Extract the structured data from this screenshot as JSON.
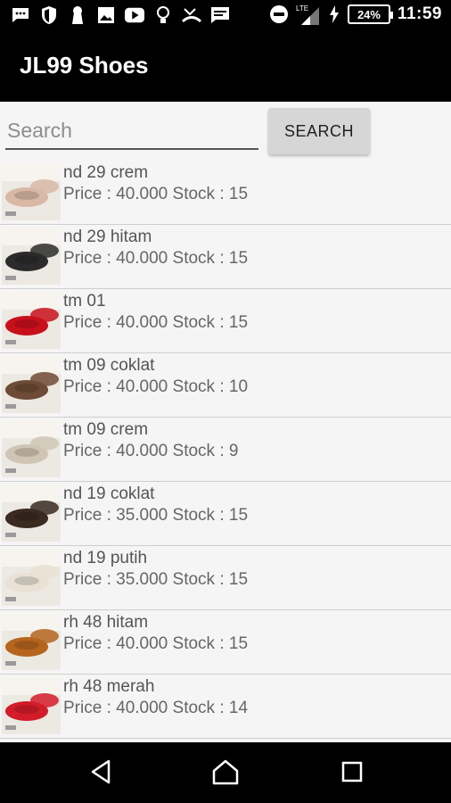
{
  "status_bar": {
    "time": "11:59",
    "battery": "24%",
    "network": "LTE",
    "icons": [
      "messages-icon",
      "shield-icon",
      "keyhole-icon",
      "image-icon",
      "youtube-icon",
      "lightbulb-icon",
      "missed-call-icon",
      "sms-icon",
      "do-not-disturb-icon",
      "signal-icon",
      "charging-icon"
    ]
  },
  "app": {
    "title": "JL99 Shoes"
  },
  "search": {
    "placeholder": "Search",
    "value": "",
    "button_label": "SEARCH"
  },
  "products": [
    {
      "name": "nd 29 crem",
      "details": "Price : 40.000 Stock : 15",
      "thumb_color": "#d9b8a6"
    },
    {
      "name": "nd 29 hitam",
      "details": "Price : 40.000 Stock : 15",
      "thumb_color": "#2b2b2b"
    },
    {
      "name": "tm 01",
      "details": "Price : 40.000 Stock : 15",
      "thumb_color": "#c8101c"
    },
    {
      "name": "tm 09 coklat",
      "details": "Price : 40.000 Stock : 10",
      "thumb_color": "#6e4b36"
    },
    {
      "name": "tm 09 crem",
      "details": "Price : 40.000 Stock : 9",
      "thumb_color": "#cfc5b4"
    },
    {
      "name": "nd 19 coklat",
      "details": "Price : 35.000 Stock : 15",
      "thumb_color": "#3a2a20"
    },
    {
      "name": "nd 19 putih",
      "details": "Price : 35.000 Stock : 15",
      "thumb_color": "#e9e2d4"
    },
    {
      "name": "rh 48 hitam",
      "details": "Price : 40.000 Stock : 15",
      "thumb_color": "#b5651d"
    },
    {
      "name": "rh 48 merah",
      "details": "Price : 40.000 Stock : 14",
      "thumb_color": "#d21c2a"
    }
  ],
  "nav": {
    "icons": [
      "back-icon",
      "home-icon",
      "recents-icon"
    ]
  }
}
